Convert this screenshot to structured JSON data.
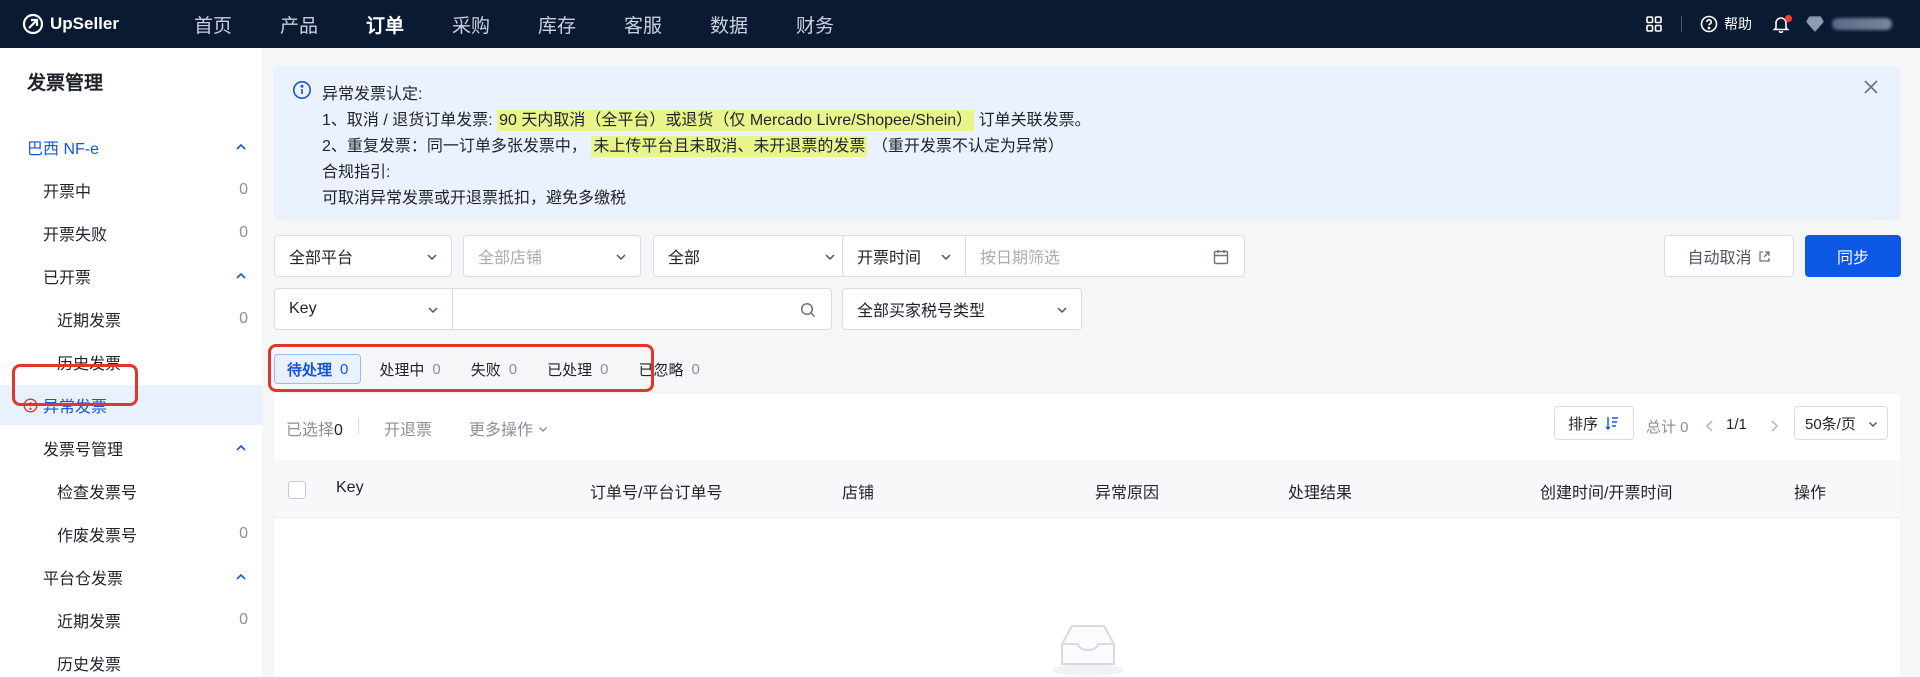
{
  "brand": {
    "name": "UpSeller"
  },
  "nav": [
    "首页",
    "产品",
    "订单",
    "采购",
    "库存",
    "客服",
    "数据",
    "财务"
  ],
  "nav_active_index": 2,
  "top_right": {
    "help_label": "帮助",
    "user_name_hidden": ""
  },
  "sidebar": {
    "title": "发票管理",
    "rows": [
      {
        "label": "巴西 NF-e",
        "type": "group",
        "count": ""
      },
      {
        "label": "开票中",
        "type": "item",
        "count": "0"
      },
      {
        "label": "开票失败",
        "type": "item",
        "count": "0"
      },
      {
        "label": "已开票",
        "type": "subgroup",
        "count": ""
      },
      {
        "label": "近期发票",
        "type": "subitem",
        "count": "0"
      },
      {
        "label": "历史发票",
        "type": "subitem",
        "count": ""
      },
      {
        "label": "异常发票",
        "type": "selected",
        "count": ""
      },
      {
        "label": "发票号管理",
        "type": "subgroup",
        "count": ""
      },
      {
        "label": "检查发票号",
        "type": "subitem",
        "count": ""
      },
      {
        "label": "作废发票号",
        "type": "subitem",
        "count": "0"
      },
      {
        "label": "平台仓发票",
        "type": "subgroup",
        "count": ""
      },
      {
        "label": "近期发票",
        "type": "subitem",
        "count": "0"
      },
      {
        "label": "历史发票",
        "type": "subitem",
        "count": ""
      }
    ]
  },
  "alert": {
    "title": "异常发票认定:",
    "line1_prefix": "1、取消 / 退货订单发票:",
    "line1_highlight": "90 天内取消（全平台）或退货（仅 Mercado Livre/Shopee/Shein）",
    "line1_suffix": "订单关联发票。",
    "line2_prefix": "2、重复发票：同一订单多张发票中，",
    "line2_highlight": "未上传平台且未取消、未开退票的发票",
    "line2_suffix": "（重开发票不认定为异常）",
    "guide_title": "合规指引:",
    "guide_text": "可取消异常发票或开退票抵扣，避免多缴税"
  },
  "filters": {
    "platform": "全部平台",
    "store_placeholder": "全部店铺",
    "status": "全部",
    "time_type": "开票时间",
    "date_placeholder": "按日期筛选",
    "search_key": "Key",
    "search_value": "",
    "buyer_tax_type": "全部买家税号类型"
  },
  "buttons": {
    "auto_cancel": "自动取消",
    "sync": "同步"
  },
  "tabs": [
    {
      "label": "待处理",
      "count": "0"
    },
    {
      "label": "处理中",
      "count": "0"
    },
    {
      "label": "失败",
      "count": "0"
    },
    {
      "label": "已处理",
      "count": "0"
    },
    {
      "label": "已忽略",
      "count": "0"
    }
  ],
  "toolbar": {
    "selected_label": "已选择",
    "selected_count": "0",
    "refund_label": "开退票",
    "more_label": "更多操作",
    "sort_label": "排序",
    "total_label": "总计 0",
    "page": "1/1",
    "page_size": "50条/页"
  },
  "table_headers": [
    "Key",
    "订单号/平台订单号",
    "店铺",
    "异常原因",
    "处理结果",
    "创建时间/开票时间",
    "操作"
  ],
  "colors": {
    "topbar": "#0b1a33",
    "accent": "#0d57e5",
    "highlight": "#e9f58a",
    "alert_bg": "#e9f2fe",
    "annotation": "#e0362c"
  }
}
